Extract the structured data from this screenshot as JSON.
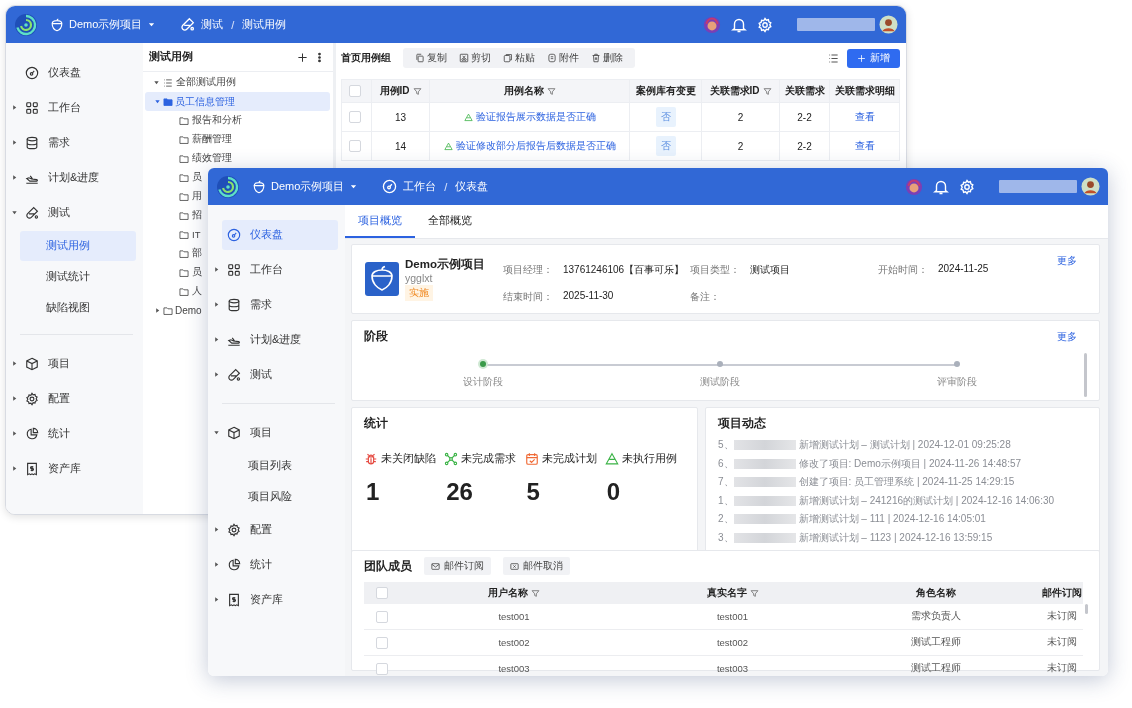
{
  "back_window": {
    "header": {
      "project": "Demo示例项目",
      "breadcrumb": [
        "测试",
        "测试用例"
      ],
      "separator": "/"
    },
    "sidebar": {
      "groups": [
        [
          {
            "label": "仪表盘",
            "selected": false
          },
          {
            "label": "工作台",
            "selected": false,
            "expanded": false
          },
          {
            "label": "需求",
            "selected": false,
            "expanded": false
          },
          {
            "label": "计划&进度",
            "selected": false,
            "expanded": false
          },
          {
            "label": "测试",
            "selected": false,
            "expanded": true,
            "children": [
              {
                "label": "测试用例",
                "selected": true
              },
              {
                "label": "测试统计",
                "selected": false
              },
              {
                "label": "缺陷视图",
                "selected": false
              }
            ]
          }
        ],
        [
          {
            "label": "项目",
            "selected": false,
            "expanded": false
          },
          {
            "label": "配置",
            "selected": false,
            "expanded": false
          },
          {
            "label": "统计",
            "selected": false,
            "expanded": false
          },
          {
            "label": "资产库",
            "selected": false,
            "expanded": false
          }
        ]
      ]
    },
    "tree": {
      "title": "测试用例",
      "root": {
        "label": "全部测试用例",
        "expanded": true,
        "children": [
          {
            "label": "员工信息管理",
            "selected": true,
            "expanded": true,
            "children": [
              {
                "label": "报告和分析",
                "selected": false
              },
              {
                "label": "薪酬管理",
                "selected": false
              },
              {
                "label": "绩效管理",
                "selected": false
              },
              {
                "label": "员",
                "selected": false
              },
              {
                "label": "用",
                "selected": false
              },
              {
                "label": "招",
                "selected": false
              },
              {
                "label": "IT",
                "selected": false
              },
              {
                "label": "部",
                "selected": false
              },
              {
                "label": "员",
                "selected": false
              },
              {
                "label": "人",
                "selected": false
              }
            ]
          },
          {
            "label": "Demo",
            "selected": false,
            "expanded": false
          }
        ]
      }
    },
    "main": {
      "group_title": "首页用例组",
      "toolbar": [
        "复制",
        "剪切",
        "粘贴",
        "附件",
        "删除"
      ],
      "add_button": "新增",
      "select_all_checked": false,
      "columns": [
        {
          "label": "用例ID",
          "filter": true
        },
        {
          "label": "用例名称",
          "filter": true
        },
        {
          "label": "案例库有变更",
          "filter": false
        },
        {
          "label": "关联需求ID",
          "filter": true
        },
        {
          "label": "关联需求",
          "filter": false
        },
        {
          "label": "关联需求明细",
          "filter": false
        }
      ],
      "rows": [
        {
          "checked": false,
          "id": "13",
          "name": "验证报告展示数据是否正确",
          "changed": "否",
          "req_id": "2",
          "req": "2-2",
          "detail": "查看"
        },
        {
          "checked": false,
          "id": "14",
          "name": "验证修改部分后报告后数据是否正确",
          "changed": "否",
          "req_id": "2",
          "req": "2-2",
          "detail": "查看"
        }
      ]
    }
  },
  "front_window": {
    "header": {
      "project": "Demo示例项目",
      "breadcrumb": [
        "工作台",
        "仪表盘"
      ],
      "separator": "/"
    },
    "sidebar": {
      "groups": [
        [
          {
            "label": "仪表盘",
            "selected": true
          },
          {
            "label": "工作台",
            "selected": false,
            "expanded": false
          },
          {
            "label": "需求",
            "selected": false,
            "expanded": false
          },
          {
            "label": "计划&进度",
            "selected": false,
            "expanded": false
          },
          {
            "label": "测试",
            "selected": false,
            "expanded": false
          }
        ],
        [
          {
            "label": "项目",
            "selected": false,
            "expanded": true,
            "children": [
              {
                "label": "项目列表",
                "selected": false
              },
              {
                "label": "项目风险",
                "selected": false
              }
            ]
          },
          {
            "label": "配置",
            "selected": false,
            "expanded": false
          },
          {
            "label": "统计",
            "selected": false,
            "expanded": false
          },
          {
            "label": "资产库",
            "selected": false,
            "expanded": false
          }
        ]
      ]
    },
    "tabs": [
      {
        "label": "项目概览",
        "selected": true
      },
      {
        "label": "全部概览",
        "selected": false
      }
    ],
    "project": {
      "name": "Demo示例项目",
      "code": "ygglxt",
      "status": "实施",
      "more": "更多",
      "fields": [
        {
          "label": "项目经理：",
          "value": "13761246106【百事可乐】"
        },
        {
          "label": "项目类型：",
          "value": "测试项目"
        },
        {
          "label": "开始时间：",
          "value": "2024-11-25"
        },
        {
          "label": "结束时间：",
          "value": "2025-11-30"
        },
        {
          "label": "备注："
        }
      ]
    },
    "stages": {
      "title": "阶段",
      "more": "更多",
      "items": [
        {
          "label": "设计阶段",
          "done": true
        },
        {
          "label": "测试阶段",
          "done": false
        },
        {
          "label": "评审阶段",
          "done": false
        }
      ]
    },
    "stats": {
      "title": "统计",
      "items": [
        {
          "kind": "defect",
          "label": "未关闭缺陷",
          "value": "1"
        },
        {
          "kind": "requirement",
          "label": "未完成需求",
          "value": "26"
        },
        {
          "kind": "plan",
          "label": "未完成计划",
          "value": "5"
        },
        {
          "kind": "case",
          "label": "未执行用例",
          "value": "0"
        }
      ]
    },
    "activity": {
      "title": "项目动态",
      "items": [
        {
          "index": "5、",
          "text": "新增测试计划 – 测试计划 | 2024-12-01 09:25:28"
        },
        {
          "index": "6、",
          "text": "修改了项目: Demo示例项目 | 2024-11-26 14:48:57"
        },
        {
          "index": "7、",
          "text": "创建了项目: 员工管理系统 | 2024-11-25 14:29:15"
        },
        {
          "index": "1、",
          "text": "新增测试计划 – 241216的测试计划 | 2024-12-16 14:06:30"
        },
        {
          "index": "2、",
          "text": "新增测试计划 – 111 | 2024-12-16 14:05:01"
        },
        {
          "index": "3、",
          "text": "新增测试计划 – 1123 | 2024-12-16 13:59:15"
        }
      ]
    },
    "team": {
      "title": "团队成员",
      "buttons": [
        "邮件订阅",
        "邮件取消"
      ],
      "select_all_checked": false,
      "columns": [
        {
          "label": "用户名称",
          "filter": true
        },
        {
          "label": "真实名字",
          "filter": true
        },
        {
          "label": "角色名称",
          "filter": false
        },
        {
          "label": "邮件订阅",
          "filter": false
        }
      ],
      "rows": [
        {
          "checked": false,
          "cells": [
            "test001",
            "test001",
            "需求负责人",
            "未订阅"
          ]
        },
        {
          "checked": false,
          "cells": [
            "test002",
            "test002",
            "测试工程师",
            "未订阅"
          ]
        },
        {
          "checked": false,
          "cells": [
            "test003",
            "test003",
            "测试工程师",
            "未订阅"
          ]
        }
      ]
    }
  }
}
